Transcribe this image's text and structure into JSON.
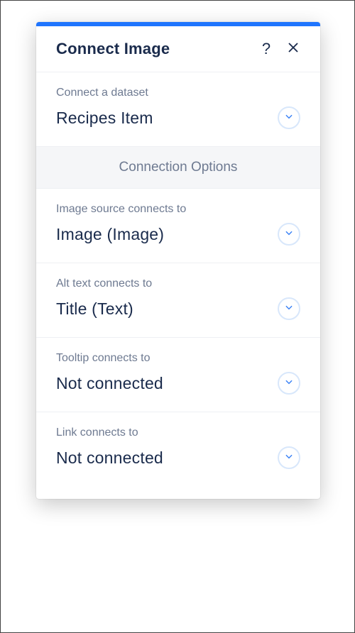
{
  "header": {
    "title": "Connect Image",
    "help_label": "?"
  },
  "dataset": {
    "label": "Connect a dataset",
    "value": "Recipes Item"
  },
  "options_banner": "Connection Options",
  "fields": [
    {
      "label": "Image source connects to",
      "value": "Image (Image)"
    },
    {
      "label": "Alt text connects to",
      "value": "Title (Text)"
    },
    {
      "label": "Tooltip connects to",
      "value": "Not connected"
    },
    {
      "label": "Link connects to",
      "value": "Not connected"
    }
  ]
}
